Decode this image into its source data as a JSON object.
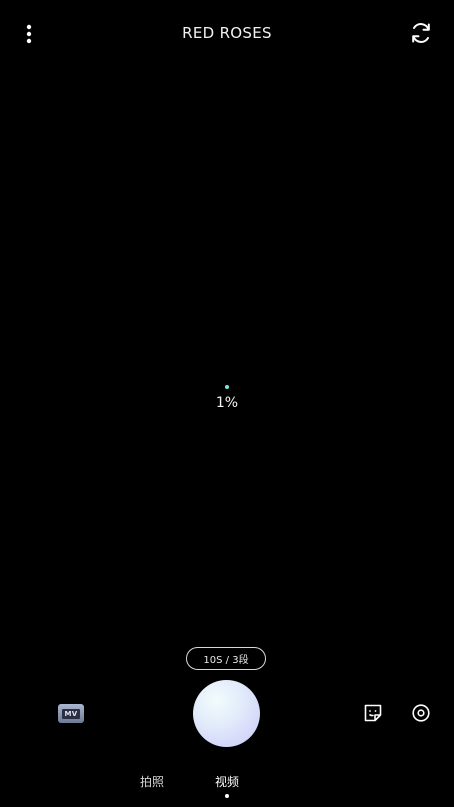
{
  "header": {
    "title": "RED ROSES",
    "menu_icon": "more-vertical-icon",
    "switch_camera_icon": "switch-camera-icon"
  },
  "loading": {
    "progress_text": "1%",
    "progress_value": 0.01
  },
  "recording": {
    "duration_label": "10S / 3段"
  },
  "bottom_controls": {
    "mv_label": "MV",
    "sticker_icon": "sticker-icon",
    "effects_icon": "effects-icon",
    "shutter_icon": "record-shutter"
  },
  "modes": {
    "photo_label": "拍照",
    "video_label": "视频",
    "active": "视频"
  },
  "colors": {
    "background": "#000000",
    "accent_dot": "#7fe6d8",
    "shutter_gradient_light": "#f2fbfb",
    "shutter_gradient_dark": "#c9cbf4"
  }
}
